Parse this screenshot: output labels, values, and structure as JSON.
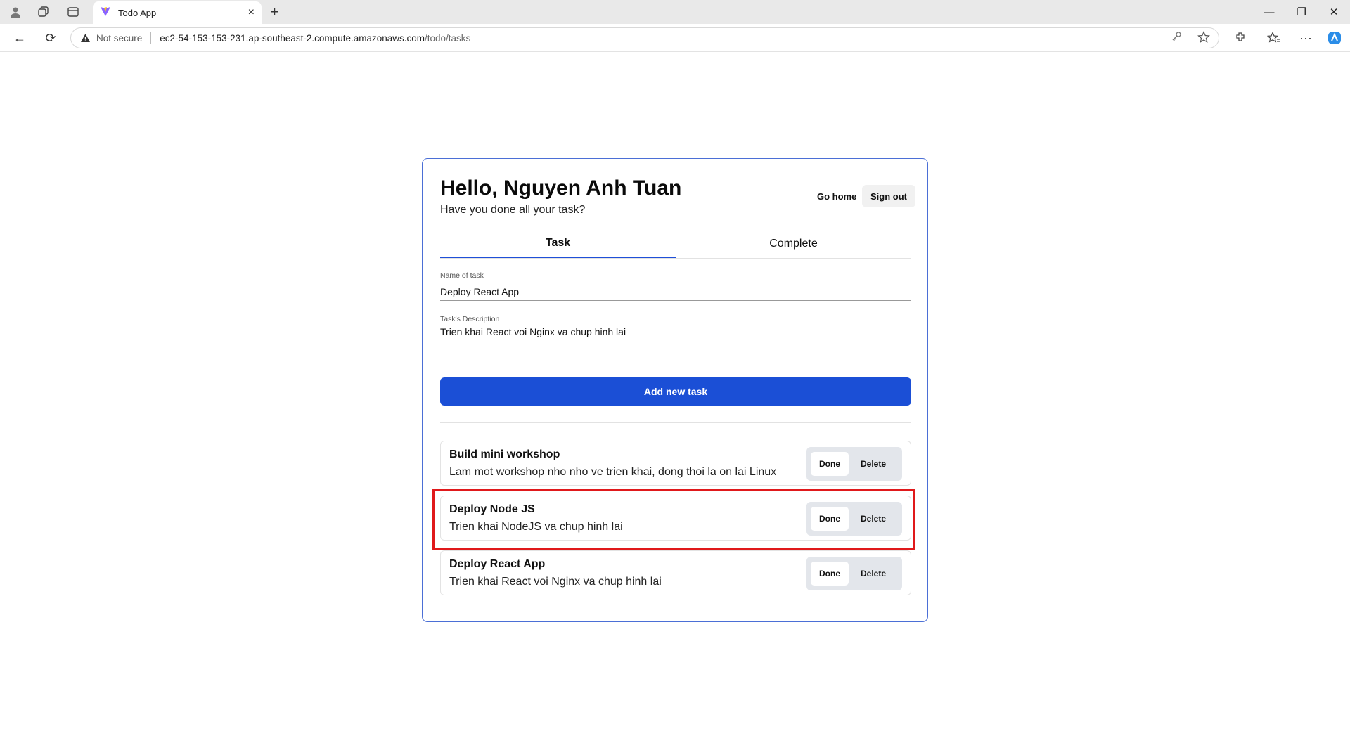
{
  "browser": {
    "tab_title": "Todo App",
    "tab_close": "×",
    "new_tab": "+",
    "not_secure": "Not secure",
    "url_host": "ec2-54-153-153-231.ap-southeast-2.compute.amazonaws.com",
    "url_path": "/todo/tasks",
    "window": {
      "minimize": "—",
      "restore": "❐",
      "close": "✕"
    },
    "nav": {
      "back": "←",
      "reload": "⟳",
      "more": "···"
    }
  },
  "header": {
    "greeting": "Hello, Nguyen Anh Tuan",
    "subtitle": "Have you done all your task?",
    "go_home": "Go home",
    "sign_out": "Sign out"
  },
  "tabs": [
    {
      "label": "Task",
      "active": true
    },
    {
      "label": "Complete",
      "active": false
    }
  ],
  "form": {
    "name_label": "Name of task",
    "name_value": "Deploy React App",
    "desc_label": "Task's Description",
    "desc_value": "Trien khai React voi Nginx va chup hinh lai",
    "submit_label": "Add new task"
  },
  "tasks": [
    {
      "title": "Build mini workshop",
      "description": "Lam mot workshop nho nho ve trien khai, dong thoi la on lai Linux",
      "done_label": "Done",
      "delete_label": "Delete"
    },
    {
      "title": "Deploy Node JS",
      "description": "Trien khai NodeJS va chup hinh lai",
      "done_label": "Done",
      "delete_label": "Delete"
    },
    {
      "title": "Deploy React App",
      "description": "Trien khai React voi Nginx va chup hinh lai",
      "done_label": "Done",
      "delete_label": "Delete"
    }
  ],
  "colors": {
    "primary": "#1b4fd6",
    "card_border": "#4b6fd6",
    "highlight": "#e0191b",
    "action_bg": "#e3e6eb"
  }
}
